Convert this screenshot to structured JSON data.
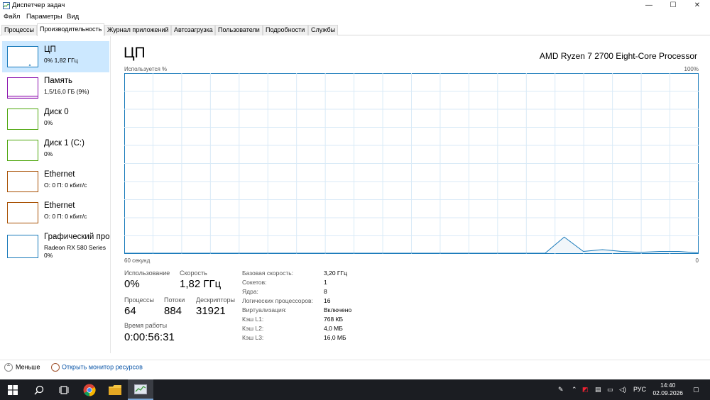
{
  "window": {
    "title": "Диспетчер задач",
    "controls": {
      "minimize": "—",
      "maximize": "☐",
      "close": "✕"
    }
  },
  "menu": {
    "file": "Файл",
    "params": "Параметры",
    "view": "Вид"
  },
  "tabs": [
    {
      "label": "Процессы"
    },
    {
      "label": "Производительность"
    },
    {
      "label": "Журнал приложений"
    },
    {
      "label": "Автозагрузка"
    },
    {
      "label": "Пользователи"
    },
    {
      "label": "Подробности"
    },
    {
      "label": "Службы"
    }
  ],
  "sidebar": {
    "items": [
      {
        "name": "ЦП",
        "sub": "0% 1,82 ГГц",
        "color": "#1779ba"
      },
      {
        "name": "Память",
        "sub": "1,5/16,0 ГБ (9%)",
        "color": "#8b12ae"
      },
      {
        "name": "Диск 0",
        "sub": "0%",
        "color": "#4da60c"
      },
      {
        "name": "Диск 1 (C:)",
        "sub": "0%",
        "color": "#4da60c"
      },
      {
        "name": "Ethernet",
        "sub": "О: 0 П: 0 кбит/с",
        "color": "#a74f01"
      },
      {
        "name": "Ethernet",
        "sub": "О: 0 П: 0 кбит/с",
        "color": "#a74f01"
      },
      {
        "name": "Графический про",
        "sub": "Radeon RX 580 Series",
        "sub2": "0%",
        "color": "#1779ba"
      }
    ]
  },
  "main": {
    "title": "ЦП",
    "model": "AMD Ryzen 7 2700 Eight-Core Processor",
    "graph_top_left": "Используется %",
    "graph_top_right": "100%",
    "graph_bottom_left": "60 секунд",
    "graph_bottom_right": "0",
    "stats": {
      "usage_label": "Использование",
      "usage_value": "0%",
      "speed_label": "Скорость",
      "speed_value": "1,82 ГГц",
      "processes_label": "Процессы",
      "processes_value": "64",
      "threads_label": "Потоки",
      "threads_value": "884",
      "handles_label": "Дескрипторы",
      "handles_value": "31921",
      "uptime_label": "Время работы",
      "uptime_value": "0:00:56:31"
    },
    "info": [
      {
        "label": "Базовая скорость:",
        "value": "3,20 ГГц"
      },
      {
        "label": "Сокетов:",
        "value": "1"
      },
      {
        "label": "Ядра:",
        "value": "8"
      },
      {
        "label": "Логических процессоров:",
        "value": "16"
      },
      {
        "label": "Виртуализация:",
        "value": "Включено"
      },
      {
        "label": "Кэш L1:",
        "value": "768 КБ"
      },
      {
        "label": "Кэш L2:",
        "value": "4,0 МБ"
      },
      {
        "label": "Кэш L3:",
        "value": "16,0 МБ"
      }
    ]
  },
  "chart_data": {
    "type": "area",
    "x": [
      60,
      56,
      52,
      48,
      44,
      40,
      36,
      32,
      28,
      24,
      20,
      16,
      14,
      12,
      10,
      8,
      6,
      4,
      2,
      0
    ],
    "series": [
      {
        "values": [
          0,
          0,
          0,
          0,
          0,
          0,
          0,
          0,
          0,
          0,
          0,
          0,
          9,
          1,
          2,
          1,
          0.5,
          1,
          1,
          0.2
        ]
      }
    ],
    "ylim": [
      0,
      100
    ],
    "xlim": [
      60,
      0
    ],
    "grid": true
  },
  "footer": {
    "less": "Меньше",
    "monitor": "Открыть монитор ресурсов"
  },
  "taskbar": {
    "lang": "РУС",
    "time": "14:40",
    "date": "02.09.2026"
  }
}
